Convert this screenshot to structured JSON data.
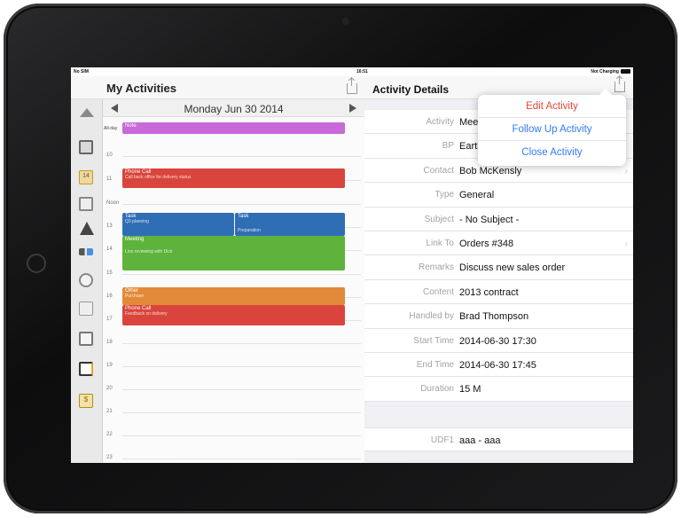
{
  "status": {
    "carrier": "No SIM",
    "time": "16:51",
    "battery_text": "Not Charging"
  },
  "left": {
    "title": "My Activities",
    "date_label": "Monday Jun 30 2014",
    "allday_label": "All-day",
    "hours": [
      "10",
      "11",
      "Noon",
      "13",
      "14",
      "15",
      "16",
      "17",
      "18",
      "19",
      "20",
      "21",
      "22",
      "23"
    ],
    "events": [
      {
        "title": "Note",
        "subtitle": "",
        "color": "#c86ad8"
      },
      {
        "title": "Phone Call",
        "subtitle": "Call back office for delivery status",
        "color": "#d9453c"
      },
      {
        "title": "Task",
        "subtitle": "Q3 planning",
        "color": "#2f6eb5"
      },
      {
        "title": "Task",
        "subtitle": "Preparation",
        "color": "#2f6eb5"
      },
      {
        "title": "Meeting",
        "subtitle": "Line reviewing with Dick",
        "color": "#5db33b"
      },
      {
        "title": "Other",
        "subtitle": "Purchase",
        "color": "#e38a3a"
      },
      {
        "title": "Phone Call",
        "subtitle": "Feedback on delivery",
        "color": "#d9453c"
      }
    ],
    "sidebar_icons": [
      "home-icon",
      "box-icon",
      "calendar-icon",
      "checklist-icon",
      "warning-icon",
      "people-icon",
      "document-icon",
      "grid-icon",
      "add-doc-icon",
      "copy-icon",
      "money-icon"
    ],
    "calendar_icon_text": "14",
    "money_icon_text": "$"
  },
  "right": {
    "title": "Activity Details",
    "rows": [
      {
        "label": "Activity",
        "value": "Meeting"
      },
      {
        "label": "BP",
        "value": "Earthshaker"
      },
      {
        "label": "Contact",
        "value": "Bob McKensly",
        "chevron": true
      },
      {
        "label": "Type",
        "value": "General"
      },
      {
        "label": "Subject",
        "value": "- No Subject -"
      },
      {
        "label": "Link To",
        "value": "Orders #348",
        "chevron": true
      },
      {
        "label": "Remarks",
        "value": "Discuss new sales order"
      },
      {
        "label": "Content",
        "value": "2013 contract"
      },
      {
        "label": "Handled by",
        "value": "Brad Thompson"
      },
      {
        "label": "Start Time",
        "value": "2014-06-30 17:30"
      },
      {
        "label": "End Time",
        "value": "2014-06-30 17:45"
      },
      {
        "label": "Duration",
        "value": "15 M"
      }
    ],
    "udf": {
      "label": "UDF1",
      "value": "aaa - aaa"
    },
    "chevron_glyph": "›"
  },
  "popover": {
    "items": [
      {
        "label": "Edit Activity",
        "color": "#e8463a"
      },
      {
        "label": "Follow Up Activity",
        "color": "#2f7cf6"
      },
      {
        "label": "Close Activity",
        "color": "#2f7cf6"
      }
    ]
  }
}
